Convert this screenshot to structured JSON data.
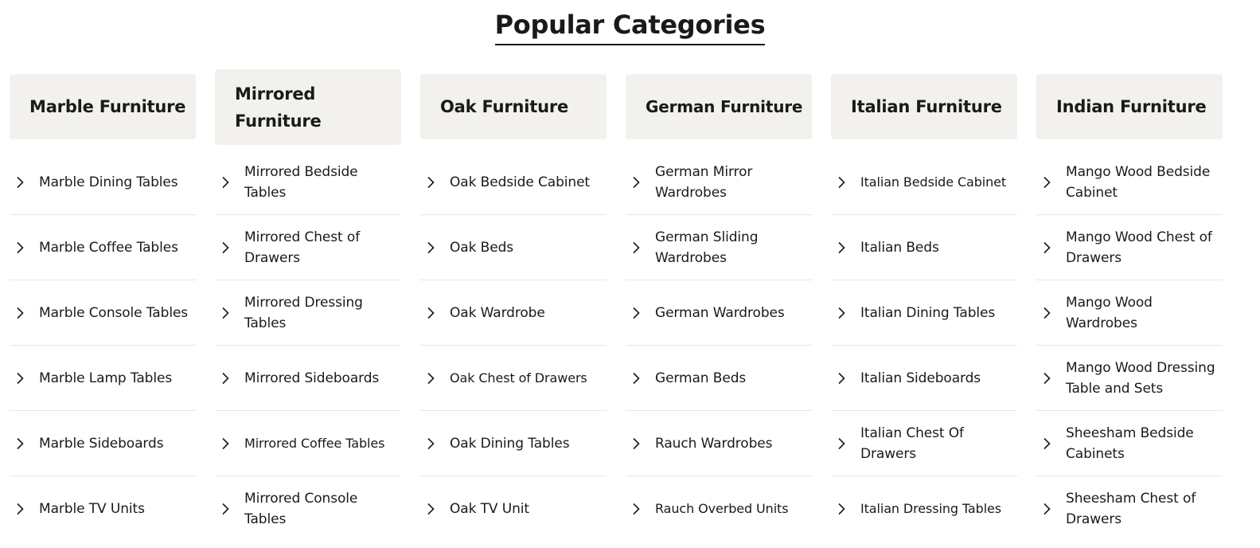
{
  "title": "Popular Categories",
  "colors": {
    "header_bg": "#f2f1ee",
    "text": "#1a1a1a",
    "divider": "#e6e6e6"
  },
  "icons": {
    "item_icon": "chevron-right-icon"
  },
  "columns": [
    {
      "heading": "Marble Furniture",
      "items": [
        {
          "label": "Marble Dining Tables"
        },
        {
          "label": "Marble Coffee Tables"
        },
        {
          "label": "Marble Console Tables"
        },
        {
          "label": "Marble Lamp Tables"
        },
        {
          "label": "Marble Sideboards"
        },
        {
          "label": "Marble TV Units"
        }
      ]
    },
    {
      "heading": "Mirrored Furniture",
      "items": [
        {
          "label": "Mirrored Bedside Tables"
        },
        {
          "label": "Mirrored Chest of Drawers"
        },
        {
          "label": "Mirrored Dressing Tables"
        },
        {
          "label": "Mirrored Sideboards"
        },
        {
          "label": "Mirrored Coffee Tables"
        },
        {
          "label": "Mirrored Console Tables"
        }
      ]
    },
    {
      "heading": "Oak Furniture",
      "items": [
        {
          "label": "Oak Bedside Cabinet"
        },
        {
          "label": "Oak Beds"
        },
        {
          "label": "Oak Wardrobe"
        },
        {
          "label": "Oak Chest of Drawers"
        },
        {
          "label": "Oak Dining Tables"
        },
        {
          "label": "Oak TV Unit"
        }
      ]
    },
    {
      "heading": "German Furniture",
      "items": [
        {
          "label": "German Mirror Wardrobes"
        },
        {
          "label": "German Sliding Wardrobes"
        },
        {
          "label": "German Wardrobes"
        },
        {
          "label": "German Beds"
        },
        {
          "label": "Rauch Wardrobes"
        },
        {
          "label": "Rauch Overbed Units"
        }
      ]
    },
    {
      "heading": "Italian Furniture",
      "items": [
        {
          "label": "Italian Bedside Cabinet"
        },
        {
          "label": "Italian Beds"
        },
        {
          "label": "Italian Dining Tables"
        },
        {
          "label": "Italian Sideboards"
        },
        {
          "label": "Italian Chest Of Drawers"
        },
        {
          "label": "Italian Dressing Tables"
        }
      ]
    },
    {
      "heading": "Indian Furniture",
      "items": [
        {
          "label": "Mango Wood Bedside Cabinet"
        },
        {
          "label": "Mango Wood Chest of Drawers"
        },
        {
          "label": "Mango Wood Wardrobes"
        },
        {
          "label": "Mango Wood Dressing Table and Sets"
        },
        {
          "label": "Sheesham Bedside Cabinets"
        },
        {
          "label": "Sheesham Chest of Drawers"
        }
      ]
    }
  ]
}
